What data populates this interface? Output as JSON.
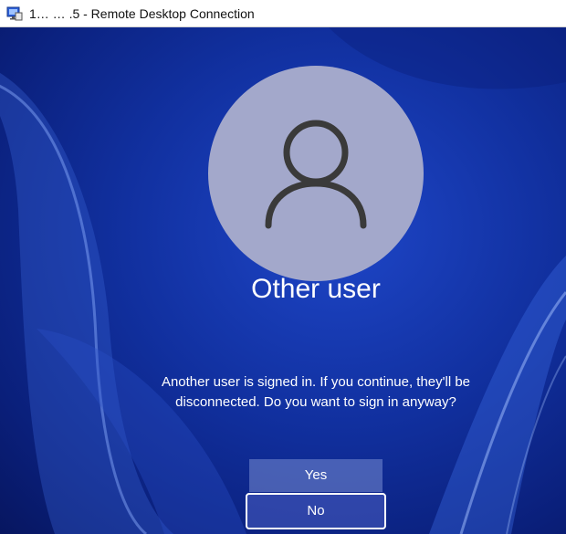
{
  "window": {
    "title": "1… … .5 - Remote Desktop Connection",
    "icon": "remote-desktop-icon"
  },
  "login": {
    "user_name": "Other user",
    "avatar_icon": "user-silhouette-icon",
    "message": "Another user is signed in. If you continue, they'll be disconnected. Do you want to sign in anyway?",
    "yes_label": "Yes",
    "no_label": "No"
  },
  "colors": {
    "background": "#0a1f7a",
    "avatar": "#a3a8cb",
    "text": "#ffffff"
  }
}
